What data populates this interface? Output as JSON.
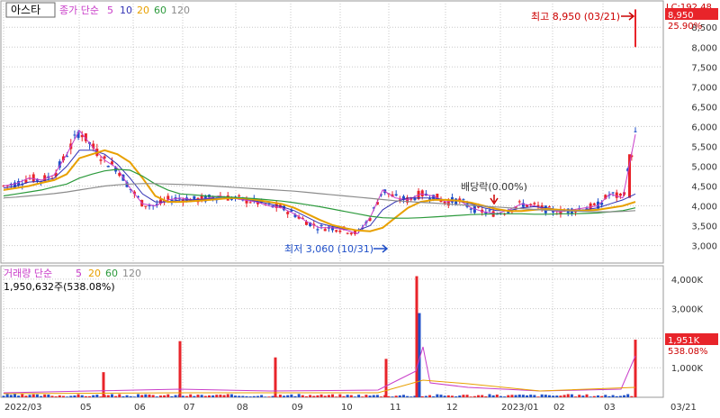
{
  "app": {
    "stock_name": "아스타",
    "price_legend": {
      "label": "종가 단순",
      "periods": [
        "5",
        "10",
        "20",
        "60",
        "120"
      ]
    },
    "volume_legend": {
      "label": "거래량 단순",
      "periods": [
        "5",
        "20",
        "60",
        "120"
      ]
    },
    "volume_info": "1,950,632주(538.08%)",
    "header_right": "LC:192.48"
  },
  "colors": {
    "up": "#e8242a",
    "down": "#1f4fc8",
    "ma5": "#c83cc8",
    "ma10": "#3232b4",
    "ma20": "#e8a000",
    "ma60": "#2c9a3c",
    "ma120": "#8c8c8c",
    "grid": "#c8c8c8",
    "axis_text": "#333333"
  },
  "chart_data": [
    {
      "type": "candlestick",
      "title": "아스타",
      "y_ticks": [
        "3,000",
        "3,500",
        "4,000",
        "4,500",
        "5,000",
        "5,500",
        "6,000",
        "6,500",
        "7,000",
        "7,500",
        "8,000",
        "8,500"
      ],
      "ylim": [
        2650,
        9050
      ],
      "price_axis_label": {
        "value": "8,950",
        "pct": "25.90%"
      },
      "annotations": [
        {
          "text": "최고 8,950 (03/21)",
          "price": 8950,
          "date": "2023/03/21"
        },
        {
          "text": "최저 3,060 (10/31)",
          "price": 3060,
          "date": "2022/10/31"
        },
        {
          "text": "배당락(0.00%)",
          "price": 4150,
          "date": "2022/12/28"
        }
      ],
      "series": [
        {
          "name": "5",
          "close": [
            4500,
            4560,
            4700,
            4650,
            4780,
            5300,
            5900,
            5500,
            5150,
            4950,
            4450,
            4050,
            4000,
            4150,
            4200,
            4150,
            4180,
            4250,
            4200,
            4150,
            4100,
            4000,
            3950,
            3800,
            3600,
            3450,
            3450,
            3400,
            3300,
            3700,
            4400,
            4200,
            4150,
            4300,
            4250,
            4100,
            4150,
            3950,
            3850,
            3800,
            3900,
            4050,
            4000,
            3900,
            3850,
            3900,
            3950,
            4000,
            4300,
            4200,
            5800
          ]
        },
        {
          "name": "10",
          "close": [
            4450,
            4500,
            4600,
            4620,
            4700,
            5000,
            5400,
            5400,
            5300,
            5050,
            4700,
            4300,
            4100,
            4100,
            4150,
            4150,
            4170,
            4200,
            4200,
            4180,
            4120,
            4050,
            3980,
            3880,
            3720,
            3560,
            3480,
            3420,
            3380,
            3500,
            3900,
            4100,
            4200,
            4200,
            4200,
            4150,
            4120,
            4050,
            3950,
            3880,
            3880,
            3950,
            3980,
            3950,
            3900,
            3880,
            3900,
            3950,
            4050,
            4150,
            4300
          ]
        },
        {
          "name": "20",
          "close": [
            4400,
            4450,
            4500,
            4580,
            4650,
            4800,
            5200,
            5300,
            5400,
            5300,
            5100,
            4700,
            4250,
            4100,
            4100,
            4120,
            4140,
            4170,
            4200,
            4190,
            4150,
            4100,
            4050,
            3950,
            3800,
            3650,
            3520,
            3440,
            3380,
            3360,
            3450,
            3700,
            3950,
            4100,
            4150,
            4150,
            4130,
            4080,
            4000,
            3920,
            3870,
            3870,
            3900,
            3920,
            3900,
            3880,
            3880,
            3900,
            3950,
            4000,
            4100
          ]
        },
        {
          "name": "60",
          "close": [
            4250,
            4300,
            4350,
            4400,
            4480,
            4550,
            4700,
            4800,
            4880,
            4920,
            4900,
            4750,
            4550,
            4400,
            4300,
            4280,
            4250,
            4230,
            4220,
            4200,
            4180,
            4150,
            4120,
            4080,
            4030,
            3980,
            3920,
            3860,
            3800,
            3740,
            3700,
            3690,
            3690,
            3700,
            3720,
            3740,
            3760,
            3780,
            3790,
            3800,
            3800,
            3800,
            3790,
            3790,
            3800,
            3800,
            3810,
            3820,
            3850,
            3880,
            3950
          ]
        },
        {
          "name": "120",
          "close": [
            4200,
            4220,
            4250,
            4280,
            4310,
            4350,
            4400,
            4450,
            4500,
            4530,
            4550,
            4560,
            4560,
            4550,
            4540,
            4530,
            4510,
            4490,
            4470,
            4450,
            4430,
            4410,
            4390,
            4370,
            4340,
            4310,
            4280,
            4250,
            4220,
            4190,
            4160,
            4130,
            4110,
            4090,
            4070,
            4050,
            4030,
            4010,
            3990,
            3970,
            3950,
            3930,
            3910,
            3890,
            3880,
            3870,
            3860,
            3850,
            3850,
            3860,
            3880
          ]
        }
      ]
    },
    {
      "type": "bar",
      "title": "거래량",
      "y_ticks": [
        "1,000K",
        "2,000K",
        "3,000K",
        "4,000K"
      ],
      "ylim": [
        0,
        4300
      ],
      "volume_axis_label": {
        "value": "1,951K",
        "pct": "538.08%"
      },
      "x_ticks": [
        "2022/03",
        "05",
        "06",
        "07",
        "08",
        "09",
        "10",
        "11",
        "12",
        "2023/01",
        "02",
        "03",
        "03/21"
      ],
      "spikes": [
        {
          "date": "2022/05",
          "value": 850
        },
        {
          "date": "2022/07",
          "value": 1900
        },
        {
          "date": "2022/08",
          "value": 1350
        },
        {
          "date": "2022/10",
          "value": 1300
        },
        {
          "date": "2022/11",
          "value": 4100
        },
        {
          "date": "2022/11",
          "value": 2850
        },
        {
          "date": "2023/03",
          "value": 1950
        }
      ]
    }
  ]
}
